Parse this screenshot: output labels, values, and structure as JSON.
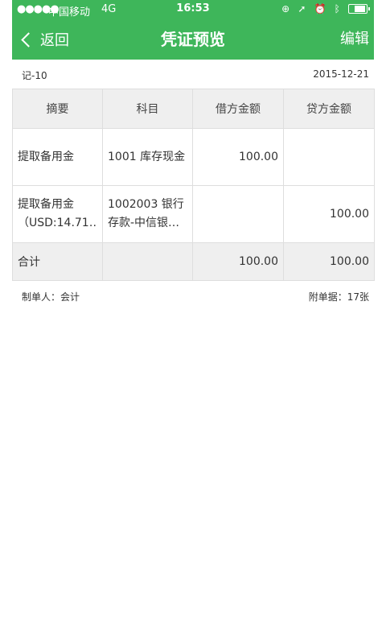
{
  "status_bar": {
    "signal": "●●●●●",
    "carrier": "中国移动",
    "network": "4G",
    "time": "16:53"
  },
  "nav": {
    "back_label": "返回",
    "title": "凭证预览",
    "edit_label": "编辑"
  },
  "voucher": {
    "number": "记-10",
    "date": "2015-12-21"
  },
  "table": {
    "headers": [
      "摘要",
      "科目",
      "借方金额",
      "贷方金额"
    ],
    "rows": [
      {
        "summary": "提取备用金",
        "account": "1001 库存现金",
        "debit": "100.00",
        "credit": ""
      },
      {
        "summary": "提取备用金（USD:14.71…",
        "account": "1002003 银行存款-中信银…",
        "debit": "",
        "credit": "100.00"
      }
    ],
    "total": {
      "label": "合计",
      "account": "",
      "debit": "100.00",
      "credit": "100.00"
    }
  },
  "footer": {
    "maker": "制单人：会计",
    "attachments": "附单据：17张"
  },
  "colors": {
    "brand_green": "#3eb65a",
    "header_gray": "#efefef",
    "border": "#dedede"
  }
}
